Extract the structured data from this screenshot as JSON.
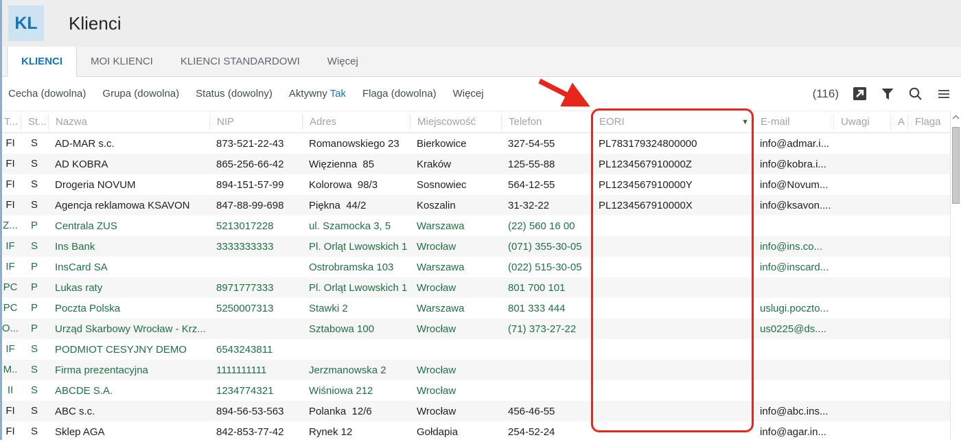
{
  "app": {
    "icon_text": "KL",
    "title": "Klienci"
  },
  "colors": {
    "accent": "#1574c0",
    "green": "#1e7145",
    "red": "#e8261b"
  },
  "tabs": [
    {
      "label": "KLIENCI",
      "active": true
    },
    {
      "label": "MOI KLIENCI",
      "active": false
    },
    {
      "label": "KLIENCI STANDARDOWI",
      "active": false
    },
    {
      "label": "Więcej",
      "active": false
    }
  ],
  "filters": [
    {
      "label": "Cecha",
      "value": "(dowolna)",
      "highlight": false
    },
    {
      "label": "Grupa",
      "value": "(dowolna)",
      "highlight": false
    },
    {
      "label": "Status",
      "value": "(dowolny)",
      "highlight": false
    },
    {
      "label": "Aktywny",
      "value": "Tak",
      "highlight": true
    },
    {
      "label": "Flaga",
      "value": "(dowolna)",
      "highlight": false
    },
    {
      "label": "Więcej",
      "value": "",
      "highlight": false
    }
  ],
  "toolbar": {
    "count": "(116)",
    "icons": [
      "export-icon",
      "filter-icon",
      "search-icon",
      "menu-icon"
    ]
  },
  "table": {
    "columns": [
      {
        "label": "T..."
      },
      {
        "label": "St..."
      },
      {
        "label": "Nazwa"
      },
      {
        "label": "NIP"
      },
      {
        "label": "Adres"
      },
      {
        "label": "Miejscowość"
      },
      {
        "label": "Telefon"
      },
      {
        "label": "EORI",
        "sorted": true
      },
      {
        "label": "E-mail"
      },
      {
        "label": "Uwagi"
      },
      {
        "label": "A"
      },
      {
        "label": "Flaga"
      }
    ],
    "rows": [
      {
        "color": "black",
        "cells": [
          "FI",
          "S",
          "AD-MAR s.c.",
          "873-521-22-43",
          "Romanowskiego 23",
          "Bierkowice",
          "327-54-55",
          "PL783179324800000",
          "info@admar.i...",
          "",
          "",
          ""
        ]
      },
      {
        "color": "black",
        "cells": [
          "FI",
          "S",
          "AD KOBRA",
          "865-256-66-42",
          "Więzienna  85",
          "Kraków",
          "125-55-88",
          "PL1234567910000Z",
          "info@kobra.i...",
          "",
          "",
          ""
        ]
      },
      {
        "color": "black",
        "cells": [
          "FI",
          "S",
          "Drogeria NOVUM",
          "894-151-57-99",
          "Kolorowa  98/3",
          "Sosnowiec",
          "564-12-55",
          "PL1234567910000Y",
          "info@Novum...",
          "",
          "",
          ""
        ]
      },
      {
        "color": "black",
        "cells": [
          "FI",
          "S",
          "Agencja reklamowa KSAVON",
          "847-88-99-698",
          "Piękna  44/2",
          "Koszalin",
          "31-32-22",
          "PL1234567910000X",
          "info@ksavon....",
          "",
          "",
          ""
        ]
      },
      {
        "color": "green",
        "cells": [
          "Z...",
          "P",
          "Centrala ZUS",
          "5213017228",
          "ul. Szamocka 3, 5",
          "Warszawa",
          "(22) 560 16 00",
          "",
          "",
          "",
          "",
          ""
        ]
      },
      {
        "color": "green",
        "cells": [
          "IF",
          "S",
          "Ins Bank",
          "3333333333",
          "Pl. Orląt Lwowskich 1",
          "Wrocław",
          "(071) 355-30-05",
          "",
          "info@ins.co...",
          "",
          "",
          ""
        ]
      },
      {
        "color": "green",
        "cells": [
          "IF",
          "P",
          "InsCard SA",
          "",
          "Ostrobramska 103",
          "Warszawa",
          "(022) 515-30-05",
          "",
          "info@inscard...",
          "",
          "",
          ""
        ]
      },
      {
        "color": "green",
        "cells": [
          "PC",
          "P",
          "Lukas raty",
          "8971777333",
          "Pl. Orląt Lwowskich 1",
          "Wrocław",
          "801 700 101",
          "",
          "",
          "",
          "",
          ""
        ]
      },
      {
        "color": "green",
        "cells": [
          "PC",
          "P",
          "Poczta Polska",
          "5250007313",
          "Stawki 2",
          "Warszawa",
          "801 333 444",
          "",
          "uslugi.poczto...",
          "",
          "",
          ""
        ]
      },
      {
        "color": "green",
        "cells": [
          "O...",
          "P",
          "Urząd Skarbowy Wrocław - Krz...",
          "",
          "Sztabowa 100",
          "Wrocław",
          "(71) 373-27-22",
          "",
          "us0225@ds....",
          "",
          "",
          ""
        ]
      },
      {
        "color": "green",
        "cells": [
          "IF",
          "S",
          "PODMIOT CESYJNY DEMO",
          "6543243811",
          "",
          "",
          "",
          "",
          "",
          "",
          "",
          ""
        ]
      },
      {
        "color": "green",
        "cells": [
          "M..",
          "S",
          "Firma prezentacyjna",
          "1111111111",
          "Jerzmanowska 2",
          "Wrocław",
          "",
          "",
          "",
          "",
          "",
          ""
        ]
      },
      {
        "color": "green",
        "cells": [
          "II",
          "S",
          "ABCDE S.A.",
          "1234774321",
          "Wiśniowa 212",
          "Wrocław",
          "",
          "",
          "",
          "",
          "",
          ""
        ]
      },
      {
        "color": "black",
        "cells": [
          "FI",
          "S",
          "ABC s.c.",
          "894-56-53-563",
          "Polanka  12/6",
          "Wrocław",
          "456-46-55",
          "",
          "info@abc.ins...",
          "",
          "",
          ""
        ]
      },
      {
        "color": "black",
        "cells": [
          "FI",
          "S",
          "Sklep AGA",
          "842-853-77-42",
          "Rynek 12",
          "Gołdapia",
          "254-52-24",
          "",
          "info@agar.in...",
          "",
          "",
          ""
        ]
      }
    ]
  },
  "annotation": {
    "target": "EORI column",
    "shapes": [
      "red-arrow",
      "red-box"
    ]
  }
}
